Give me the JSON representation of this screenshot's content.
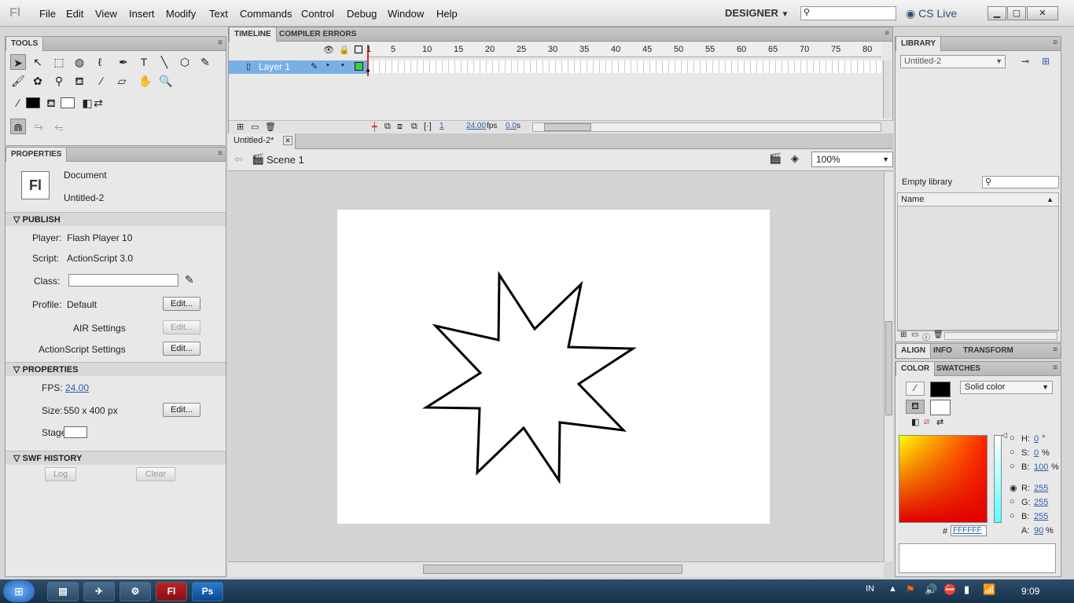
{
  "app": {
    "logo": "Fl",
    "workspace": "DESIGNER",
    "cs_live": "CS Live"
  },
  "menu": [
    "File",
    "Edit",
    "View",
    "Insert",
    "Modify",
    "Text",
    "Commands",
    "Control",
    "Debug",
    "Window",
    "Help"
  ],
  "tools_panel": {
    "title": "TOOLS"
  },
  "properties": {
    "title": "PROPERTIES",
    "doc_type": "Document",
    "doc_name": "Untitled-2",
    "publish_header": "PUBLISH",
    "player_label": "Player:",
    "player_value": "Flash Player 10",
    "script_label": "Script:",
    "script_value": "ActionScript 3.0",
    "class_label": "Class:",
    "profile_label": "Profile:",
    "profile_value": "Default",
    "edit_label": "Edit...",
    "air_settings": "AIR Settings",
    "as_settings": "ActionScript Settings",
    "props_header": "PROPERTIES",
    "fps_label": "FPS:",
    "fps_value": "24.00",
    "size_label": "Size:",
    "size_value": "550 x 400 px",
    "stage_label": "Stage:",
    "swf_header": "SWF HISTORY",
    "log_label": "Log",
    "clear_label": "Clear"
  },
  "timeline": {
    "tab_timeline": "TIMELINE",
    "tab_errors": "COMPILER ERRORS",
    "frame_numbers": [
      "1",
      "5",
      "10",
      "15",
      "20",
      "25",
      "30",
      "35",
      "40",
      "45",
      "50",
      "55",
      "60",
      "65",
      "70",
      "75",
      "80"
    ],
    "layer_name": "Layer 1",
    "current_frame": "1",
    "fps": "24.00",
    "fps_unit": "fps",
    "time": "0.0",
    "time_unit": "s"
  },
  "document": {
    "tab": "Untitled-2*",
    "scene": "Scene 1",
    "zoom": "100%"
  },
  "library": {
    "title": "LIBRARY",
    "doc_select": "Untitled-2",
    "empty_text": "Empty library",
    "col_name": "Name"
  },
  "align_panel": {
    "tabs": [
      "ALIGN",
      "INFO",
      "TRANSFORM"
    ]
  },
  "color_panel": {
    "tabs": [
      "COLOR",
      "SWATCHES"
    ],
    "fill_type": "Solid color",
    "h_label": "H:",
    "h_value": "0",
    "h_unit": "°",
    "s_label": "S:",
    "s_value": "0",
    "s_unit": "%",
    "b_label": "B:",
    "b_value": "100",
    "b_unit": "%",
    "r_label": "R:",
    "r_value": "255",
    "g_label": "G:",
    "g_value": "255",
    "bb_label": "B:",
    "bb_value": "255",
    "a_label": "A:",
    "a_value": "90",
    "a_unit": "%",
    "hex_label": "#",
    "hex_value": "FFFFFF",
    "stroke_color": "#000000",
    "fill_color": "#FFFFFF"
  },
  "taskbar": {
    "lang": "IN",
    "clock": "9:09"
  },
  "colors": {
    "accent": "#2a5db0",
    "selected_layer": "#7aaee6",
    "playhead": "#d62a2a"
  }
}
